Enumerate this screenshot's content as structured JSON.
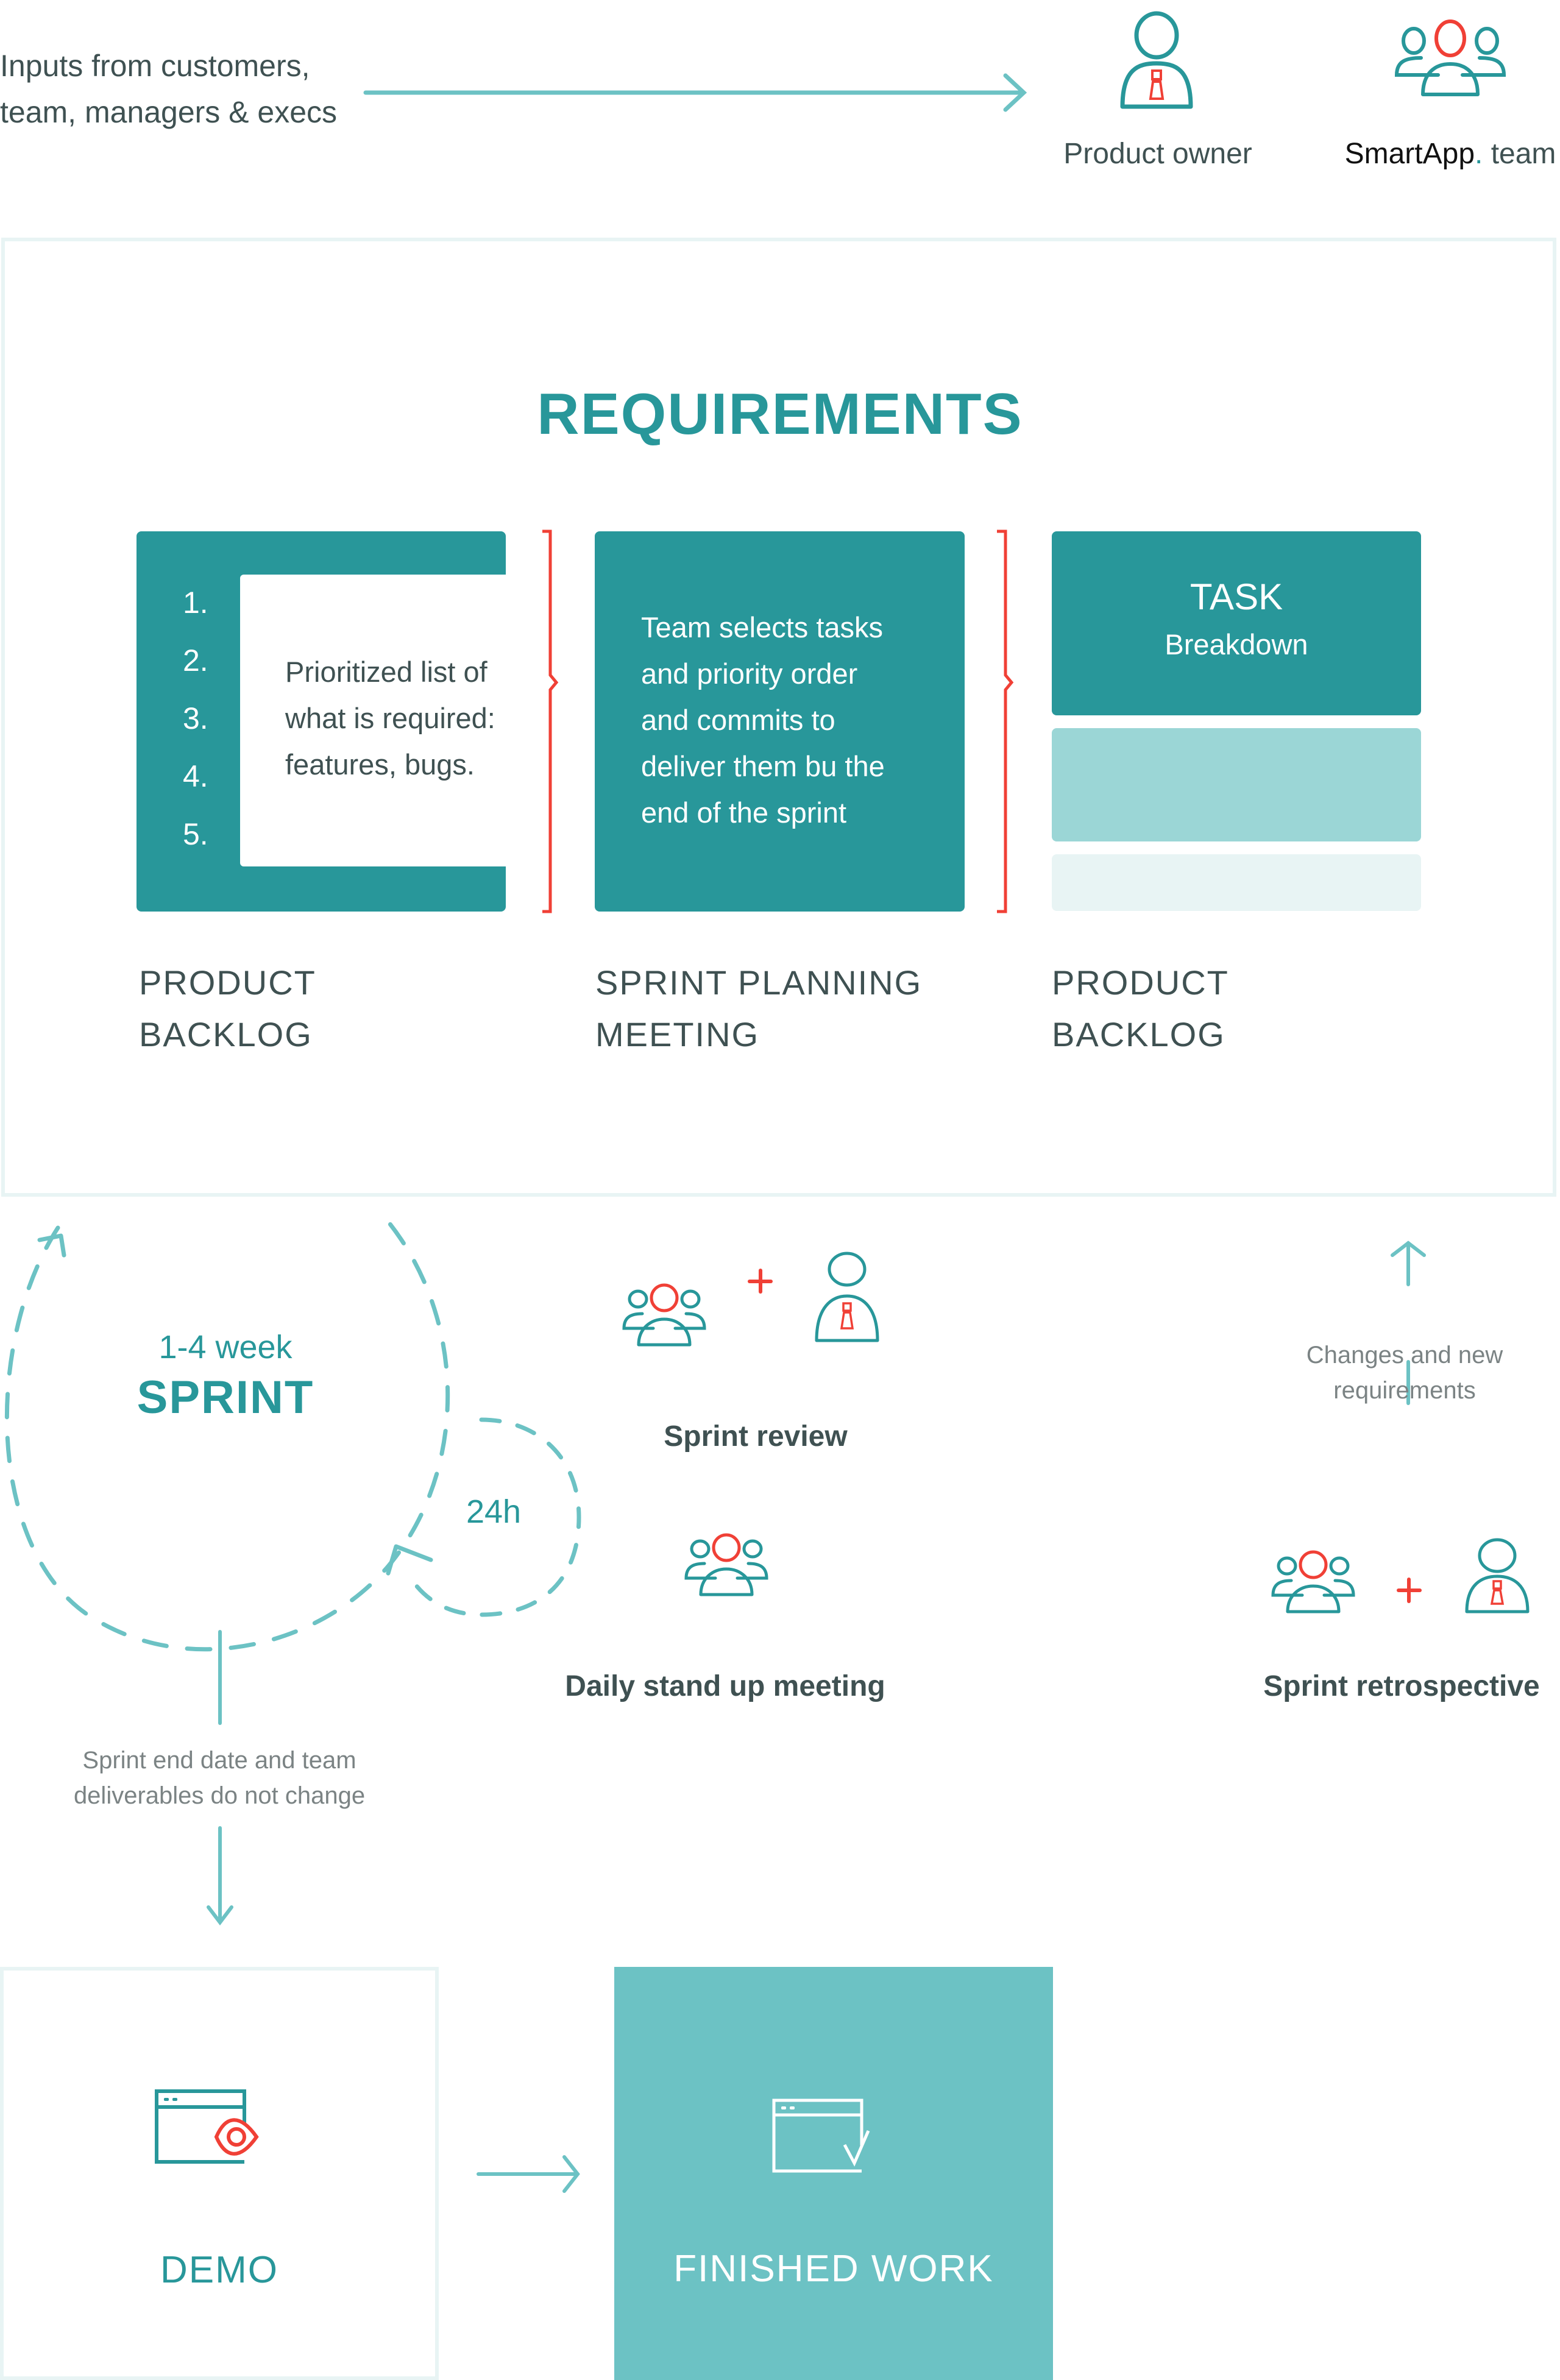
{
  "colors": {
    "teal": "#28979a",
    "light_teal": "#6cc2c4",
    "pale_teal": "#9bd6d6",
    "frame": "#e8f4f4",
    "red": "#f04036",
    "text_dark": "#3f5152",
    "text_grey": "#7b8384"
  },
  "header": {
    "inputs_line1": "Inputs from customers,",
    "inputs_line2": "team, managers & execs",
    "product_owner": {
      "icon": "product-owner-icon",
      "label": "Product owner"
    },
    "team": {
      "icon": "team-icon",
      "brand": "SmartApp",
      "brand_dot": ".",
      "label": " team"
    }
  },
  "requirements": {
    "title": "REQUIREMENTS",
    "backlog": {
      "numbers": [
        "1.",
        "2.",
        "3.",
        "4.",
        "5."
      ],
      "text_lines": [
        "Prioritized list of",
        "what is required:",
        "features, bugs."
      ],
      "label_line1": "PRODUCT",
      "label_line2": "BACKLOG"
    },
    "planning": {
      "text_lines": [
        "Team selects tasks",
        "and priority order",
        "and commits to",
        "deliver them bu the",
        "end of the sprint"
      ],
      "label_line1": "SPRINT PLANNING",
      "label_line2": "MEETING"
    },
    "task": {
      "title": "TASK",
      "subtitle": "Breakdown",
      "label_line1": "PRODUCT",
      "label_line2": "BACKLOG"
    }
  },
  "sprint": {
    "duration": "1-4 week",
    "title": "SPRINT",
    "daily_cycle": "24h",
    "review_label": "Sprint review",
    "standup_label": "Daily stand up meeting",
    "retro_label": "Sprint retrospective",
    "changes_line1": "Changes and new",
    "changes_line2": "requirements",
    "end_line1": "Sprint end date and team",
    "end_line2": "deliverables do not change",
    "plus_symbol": "+"
  },
  "outcome": {
    "demo_label": "DEMO",
    "finished_label": "FINISHED WORK"
  }
}
